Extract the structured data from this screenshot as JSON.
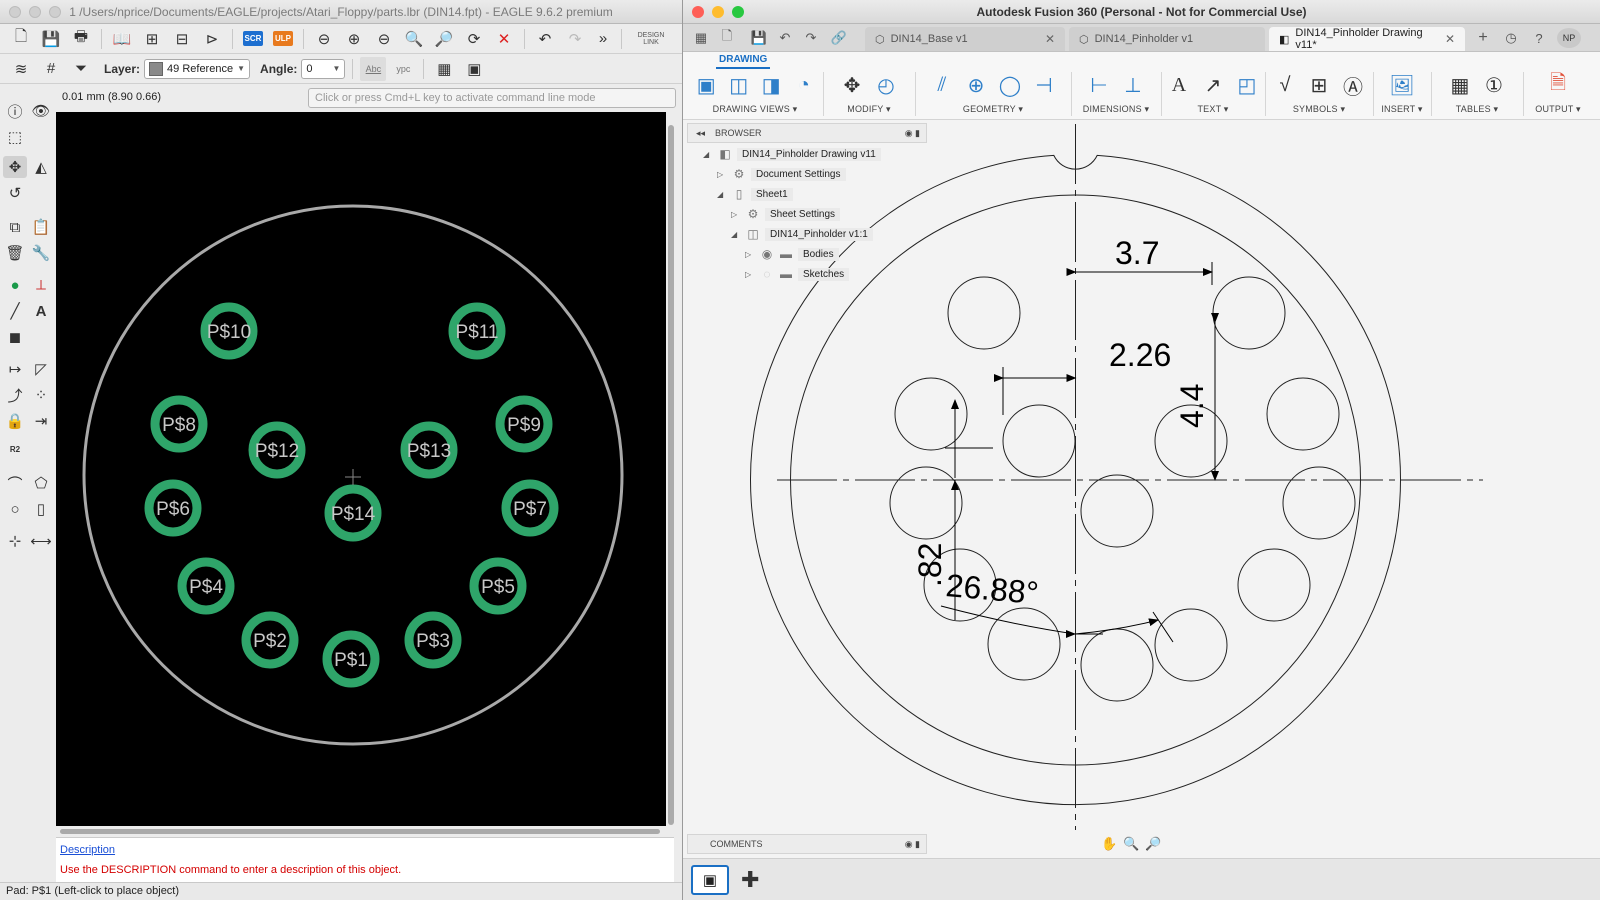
{
  "eagle": {
    "title": "1 /Users/nprice/Documents/EAGLE/projects/Atari_Floppy/parts.lbr (DIN14.fpt) - EAGLE 9.6.2 premium",
    "toolbar": {
      "scr_label": "SCR",
      "ulp_label": "ULP",
      "design_link_label": "DESIGN LINK",
      "layer_label": "Layer:",
      "layer_value": "49 Reference",
      "layer_color": "#8a8a8a",
      "angle_label": "Angle:",
      "angle_value": "0",
      "abc_label": "Abc",
      "ypc_label": "ypc"
    },
    "coord_readout": "0.01 mm (8.90 0.66)",
    "command_placeholder": "Click or press Cmd+L key to activate command line mode",
    "pads": [
      "P$10",
      "P$11",
      "P$8",
      "P$12",
      "P$13",
      "P$9",
      "P$6",
      "P$14",
      "P$7",
      "P$4",
      "P$5",
      "P$2",
      "P$3",
      "P$1"
    ],
    "pad_color": "#2fa56a",
    "description_link": "Description",
    "description_note": "Use the DESCRIPTION command to enter a description of this object.",
    "status": "Pad: P$1 (Left-click to place object)"
  },
  "fusion": {
    "title": "Autodesk Fusion 360 (Personal - Not for Commercial Use)",
    "tabs": [
      "DIN14_Base v1",
      "DIN14_Pinholder v1",
      "DIN14_Pinholder Drawing v11*"
    ],
    "user_initials": "NP",
    "ribbon_tab": "DRAWING",
    "groups": [
      "DRAWING VIEWS ▾",
      "MODIFY ▾",
      "GEOMETRY ▾",
      "DIMENSIONS ▾",
      "TEXT ▾",
      "SYMBOLS ▾",
      "INSERT ▾",
      "TABLES ▾",
      "OUTPUT ▾"
    ],
    "browser_label": "BROWSER",
    "tree": [
      "DIN14_Pinholder Drawing v11",
      "Document Settings",
      "Sheet1",
      "Sheet Settings",
      "DIN14_Pinholder v1:1",
      "Bodies",
      "Sketches"
    ],
    "comments_label": "COMMENTS",
    "dimensions": {
      "d1": "3.7",
      "d2": "2.26",
      "d3": "4.4",
      "d4": ".82",
      "d5": "26.88°"
    },
    "accent_color": "#1a6fc4"
  }
}
